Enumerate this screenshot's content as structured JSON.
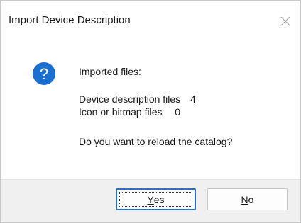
{
  "window": {
    "title": "Import Device Description",
    "close_icon": "close-icon"
  },
  "message": {
    "icon": "question-icon",
    "heading": "Imported files:",
    "rows": [
      {
        "label": "Device description files",
        "value": "4"
      },
      {
        "label": "Icon or bitmap files",
        "value": "0"
      }
    ],
    "question": "Do you want to reload the catalog?"
  },
  "buttons": {
    "yes": {
      "accel": "Y",
      "rest": "es"
    },
    "no": {
      "accel": "N",
      "rest": "o"
    }
  },
  "colors": {
    "icon_blue": "#1b6fd0",
    "default_border": "#2e6fc2"
  }
}
